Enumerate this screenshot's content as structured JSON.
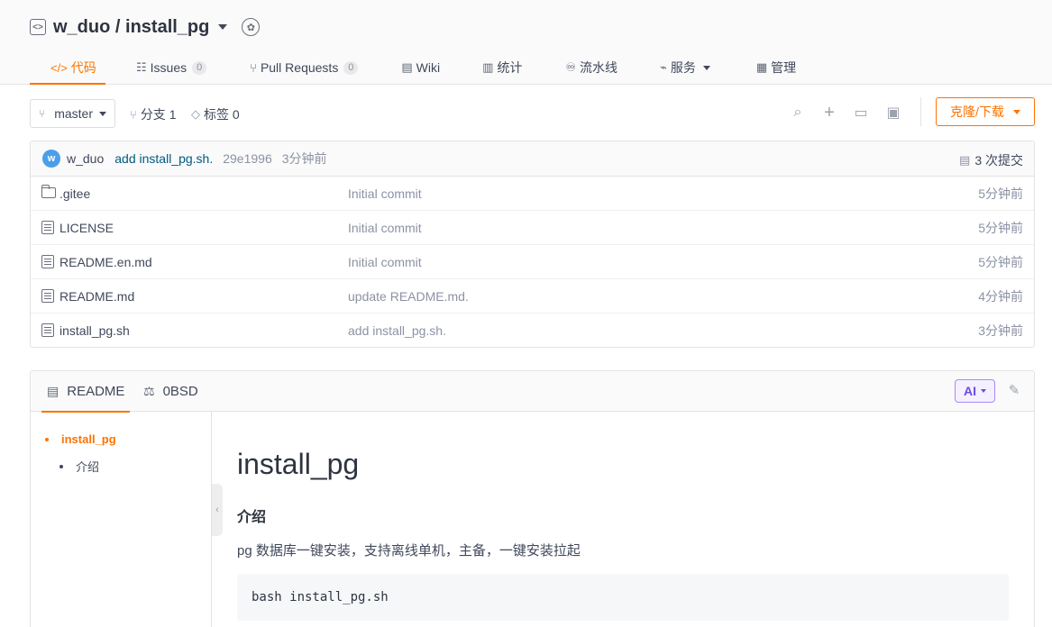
{
  "repo": {
    "owner": "w_duo",
    "separator": " / ",
    "name": "install_pg"
  },
  "tabs": [
    {
      "icon": "</>",
      "label": "代码",
      "active": true
    },
    {
      "icon": "☷",
      "label": "Issues",
      "count": "0"
    },
    {
      "icon": "⑂",
      "label": "Pull Requests",
      "count": "0"
    },
    {
      "icon": "▤",
      "label": "Wiki"
    },
    {
      "icon": "▥",
      "label": "统计"
    },
    {
      "icon": "♾",
      "label": "流水线"
    },
    {
      "icon": "⌁",
      "label": "服务"
    },
    {
      "icon": "▦",
      "label": "管理"
    }
  ],
  "toolbar": {
    "branch": "master",
    "branches_label": "分支 1",
    "tags_label": "标签 0",
    "clone_label": "克隆/下载"
  },
  "last_commit": {
    "avatar_letter": "w",
    "author": "w_duo",
    "message": "add install_pg.sh.",
    "hash": "29e1996",
    "time": "3分钟前",
    "count_label": "3 次提交"
  },
  "files": [
    {
      "type": "folder",
      "name": ".gitee",
      "message": "Initial commit",
      "time": "5分钟前"
    },
    {
      "type": "doc",
      "name": "LICENSE",
      "message": "Initial commit",
      "time": "5分钟前"
    },
    {
      "type": "doc",
      "name": "README.en.md",
      "message": "Initial commit",
      "time": "5分钟前"
    },
    {
      "type": "doc",
      "name": "README.md",
      "message": "update README.md.",
      "time": "4分钟前"
    },
    {
      "type": "doc",
      "name": "install_pg.sh",
      "message": "add install_pg.sh.",
      "time": "3分钟前"
    }
  ],
  "readme": {
    "tab_readme": "README",
    "tab_license": "0BSD",
    "ai_label": "AI",
    "toc": [
      "install_pg",
      "介绍"
    ],
    "h1": "install_pg",
    "h2": "介绍",
    "paragraph": "pg 数据库一键安装，支持离线单机，主备，一键安装拉起",
    "code": "bash install_pg.sh"
  }
}
